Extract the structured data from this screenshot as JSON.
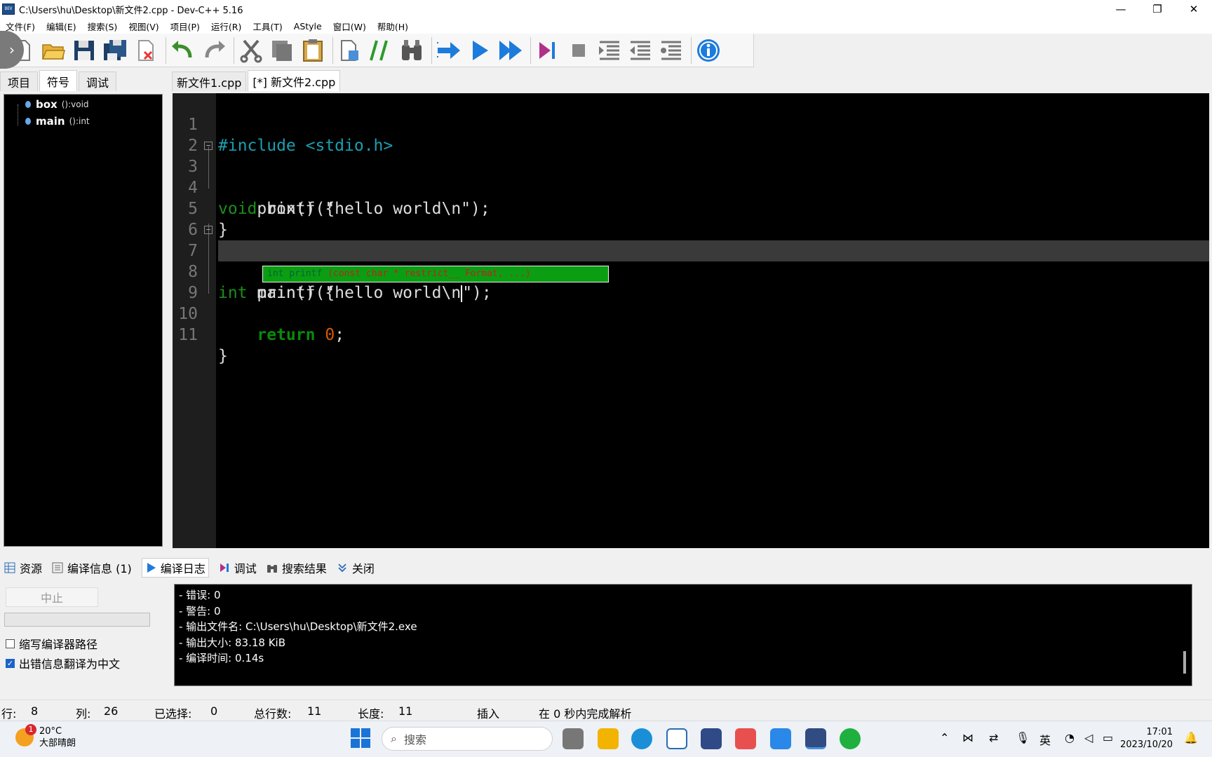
{
  "window": {
    "title": "C:\\Users\\hu\\Desktop\\新文件2.cpp - Dev-C++ 5.16",
    "app_icon_label": "DEV",
    "controls": [
      "minimize",
      "restore",
      "close"
    ]
  },
  "menu": [
    "文件(F)",
    "编辑(E)",
    "搜索(S)",
    "视图(V)",
    "项目(P)",
    "运行(R)",
    "工具(T)",
    "AStyle",
    "窗口(W)",
    "帮助(H)"
  ],
  "toolbar_icons": [
    "new-file-icon",
    "open-folder-icon",
    "save-icon",
    "save-all-icon",
    "close-file-icon",
    "undo-icon",
    "redo-icon",
    "cut-icon",
    "copy-icon",
    "paste-icon",
    "new-project-icon",
    "comment-icon",
    "find-icon",
    "compile-icon",
    "run-icon",
    "compile-run-icon",
    "debug-icon",
    "stop-icon",
    "indent-icon",
    "unindent-icon",
    "toggle-icon",
    "about-icon"
  ],
  "left_panel": {
    "tabs": [
      "项目",
      "符号",
      "调试"
    ],
    "active_tab": 1,
    "symbols": [
      {
        "name": "box",
        "type": "():void"
      },
      {
        "name": "main",
        "type": "():int"
      }
    ]
  },
  "editor": {
    "tabs": [
      "新文件1.cpp",
      "[*] 新文件2.cpp"
    ],
    "active_tab": 1,
    "line_numbers": [
      "1",
      "2",
      "3",
      "4",
      "5",
      "6",
      "7",
      "8",
      "9",
      "10",
      "11"
    ],
    "current_line": 8,
    "code": {
      "l1": "#include <stdio.h>",
      "l3_kw": "void",
      "l3_rest": " box() {",
      "l4": "    printf(\"hello world\\n\");",
      "l5": "}",
      "l7_kw": "int",
      "l7_rest": " main() {",
      "l8_a": "    printf(\"hello world\\n",
      "l8_b": "\");",
      "l10_indent": "    ",
      "l10_kw": "return",
      "l10_num": "0",
      "l10_end": ";",
      "l11": "}"
    },
    "hint": {
      "prefix": "int printf ",
      "params": "(const char * restrict__ Format, ...)"
    }
  },
  "bottom_tabs": [
    "资源",
    "编译信息 (1)",
    "编译日志",
    "调试",
    "搜索结果",
    "关闭"
  ],
  "bottom_active_tab": 2,
  "compile_panel": {
    "stop_label": "中止",
    "checkbox1_label": "缩写编译器路径",
    "checkbox1_checked": false,
    "checkbox2_label": "出错信息翻译为中文",
    "checkbox2_checked": true,
    "log": [
      "- 错误: 0",
      "- 警告: 0",
      "- 输出文件名: C:\\Users\\hu\\Desktop\\新文件2.exe",
      "- 输出大小: 83.18 KiB",
      "- 编译时间: 0.14s"
    ]
  },
  "status": {
    "row_label": "行:",
    "row": "8",
    "col_label": "列:",
    "col": "26",
    "sel_label": "已选择:",
    "sel": "0",
    "total_label": "总行数:",
    "total": "11",
    "len_label": "长度:",
    "len": "11",
    "mode": "插入",
    "msg": "在 0 秒内完成解析"
  },
  "taskbar": {
    "weather_temp": "20°C",
    "weather_desc": "大部晴朗",
    "weather_badge": "1",
    "search_placeholder": "搜索",
    "ime": "英",
    "time": "17:01",
    "date": "2023/10/20"
  },
  "colors": {
    "editor_bg": "#000000",
    "keyword": "#1b8f1b",
    "preprocessor": "#1a9fb0",
    "number": "#d65a00",
    "hint_bg": "#0b9e13",
    "accent_blue": "#1a74d8"
  }
}
